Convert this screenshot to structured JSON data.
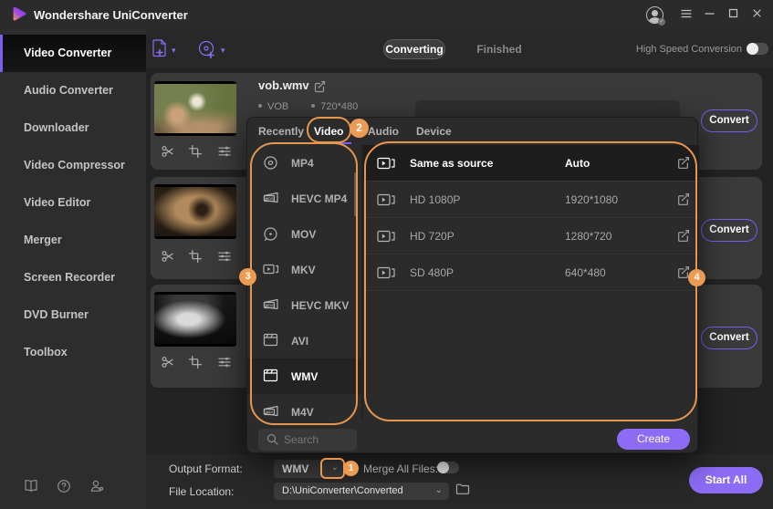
{
  "titlebar": {
    "app_title": "Wondershare UniConverter"
  },
  "sidebar": {
    "items": [
      {
        "label": "Video Converter",
        "active": true
      },
      {
        "label": "Audio Converter"
      },
      {
        "label": "Downloader"
      },
      {
        "label": "Video Compressor"
      },
      {
        "label": "Video Editor"
      },
      {
        "label": "Merger"
      },
      {
        "label": "Screen Recorder"
      },
      {
        "label": "DVD Burner"
      },
      {
        "label": "Toolbox"
      }
    ]
  },
  "toolbar": {
    "tabs": [
      {
        "label": "Converting",
        "active": true
      },
      {
        "label": "Finished",
        "active": false
      }
    ],
    "high_speed_label": "High Speed Conversion"
  },
  "files": {
    "items": [
      {
        "name": "vob.wmv",
        "format": "VOB",
        "resolution": "720*480",
        "convert_label": "Convert"
      },
      {
        "convert_label": "Convert"
      },
      {
        "convert_label": "Convert"
      }
    ]
  },
  "popup": {
    "tabs": [
      {
        "label": "Recently"
      },
      {
        "label": "Video",
        "active": true
      },
      {
        "label": "Audio"
      },
      {
        "label": "Device"
      }
    ],
    "formats": [
      {
        "label": "MP4",
        "icon": "disc-icon"
      },
      {
        "label": "HEVC MP4",
        "icon": "hevc-icon"
      },
      {
        "label": "MOV",
        "icon": "disc-dot-icon"
      },
      {
        "label": "MKV",
        "icon": "video-camera-icon"
      },
      {
        "label": "HEVC MKV",
        "icon": "hevc-icon"
      },
      {
        "label": "AVI",
        "icon": "film-icon"
      },
      {
        "label": "WMV",
        "icon": "film-icon",
        "active": true
      },
      {
        "label": "M4V",
        "icon": "m4v-icon"
      }
    ],
    "presets": [
      {
        "label": "Same as source",
        "value": "Auto",
        "active": true
      },
      {
        "label": "HD 1080P",
        "value": "1920*1080"
      },
      {
        "label": "HD 720P",
        "value": "1280*720"
      },
      {
        "label": "SD 480P",
        "value": "640*480"
      }
    ],
    "search_placeholder": "Search",
    "create_label": "Create"
  },
  "bottom_bar": {
    "output_format_label": "Output Format:",
    "output_format_value": "WMV",
    "merge_label": "Merge All Files:",
    "file_location_label": "File Location:",
    "file_location_value": "D:\\UniConverter\\Converted",
    "start_all_label": "Start All"
  },
  "annotations": {
    "steps": [
      "1",
      "2",
      "3",
      "4"
    ]
  },
  "colors": {
    "accent_purple": "#8C6CF5",
    "annotation_orange": "#E8954E"
  }
}
